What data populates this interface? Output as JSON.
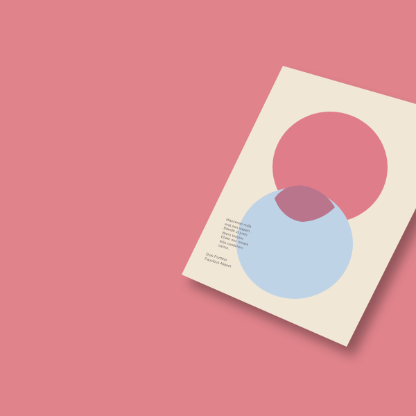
{
  "scene": {
    "background_color": "#e0838b",
    "poster_color": "#f3ead9",
    "circle_top_color": "#e07d8a",
    "circle_bottom_color": "#bfd3e6",
    "overlap_color": "#b8758c"
  },
  "poster": {
    "body_lines": [
      "Maecenas nulla",
      "erat non sapien.",
      "Blandit ut justo",
      "libero tempor.",
      "Etiam nec ornare",
      "felis condimen",
      "varius."
    ],
    "credit_lines": [
      "Duis Porttitor",
      "Faucibus Aliquet"
    ]
  }
}
